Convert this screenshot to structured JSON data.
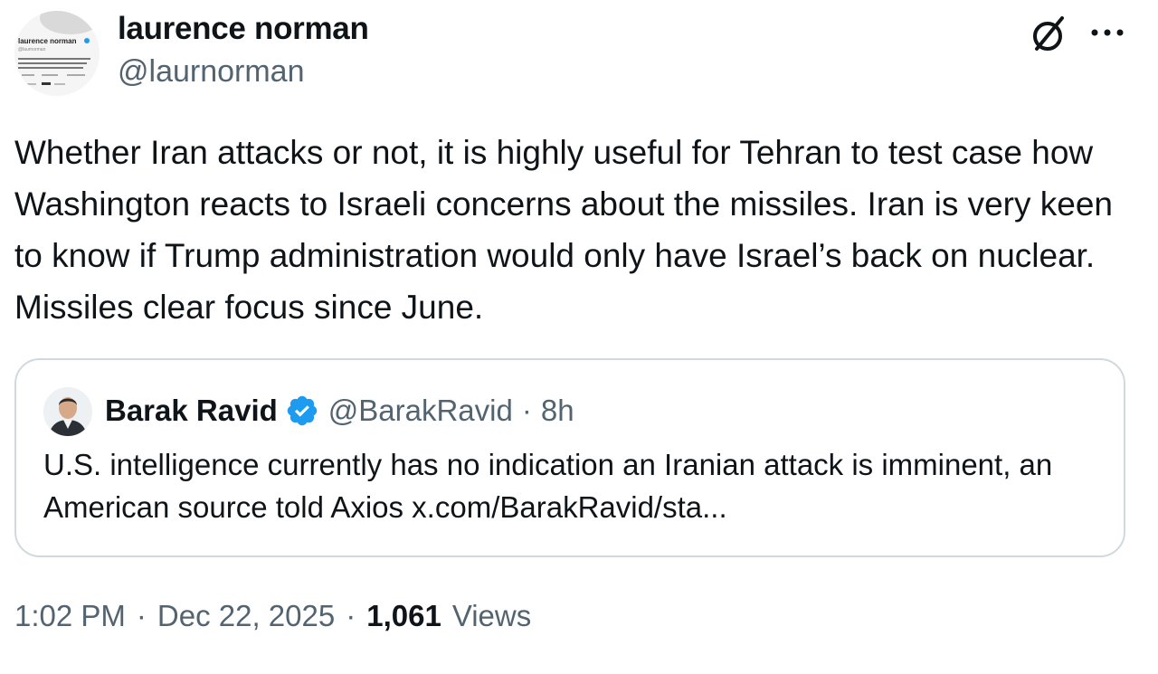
{
  "author": {
    "name": "laurence norman",
    "handle": "@laurnorman",
    "avatar_mini_name": "laurence norman",
    "avatar_mini_handle": "@laurnorman",
    "avatar_mini_bio": "In Europe for The Wall Street Journal: nuclear, EU, European foreign policy that comes my way. My RT, ecomer"
  },
  "tweet": {
    "text": "Whether Iran attacks or not, it is highly useful for Tehran to test case how Washington reacts to Israeli concerns about the missiles. Iran is very keen to know if Trump administration would only have Israel’s back on nuclear. Missiles clear focus since June."
  },
  "quoted": {
    "name": "Barak Ravid",
    "handle": "@BarakRavid",
    "separator": "·",
    "time": "8h",
    "text": "U.S. intelligence currently has no indication an Iranian attack is imminent, an American source told Axios x.com/BarakRavid/sta...",
    "verified_color": "#1d9bf0"
  },
  "meta": {
    "time": "1:02 PM",
    "sep1": "·",
    "date": "Dec 22, 2025",
    "sep2": "·",
    "views_count": "1,061",
    "views_label": "Views"
  },
  "icons": {
    "grok": "grok-icon",
    "more": "more-icon",
    "verified": "verified-badge-icon"
  },
  "colors": {
    "text": "#0f1419",
    "secondary": "#536471",
    "border": "#cfd9de",
    "verified": "#1d9bf0"
  }
}
